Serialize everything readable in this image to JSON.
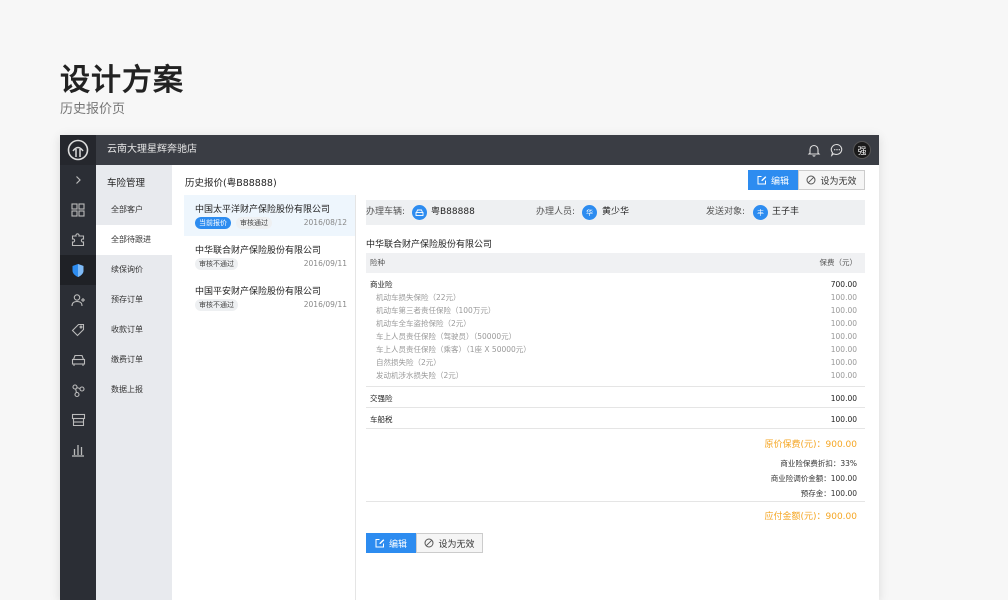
{
  "page": {
    "title": "设计方案",
    "subtitle": "历史报价页"
  },
  "topbar": {
    "store_name": "云南大理星辉奔驰店",
    "avatar": "强",
    "icons": [
      "bell-icon",
      "message-icon"
    ]
  },
  "iconbar": {
    "items": [
      "chevron-right-icon",
      "grid-icon",
      "puzzle-icon",
      "shield-icon",
      "add-user-icon",
      "tag-icon",
      "car-icon",
      "nodes-icon",
      "store-icon",
      "bar-chart-icon"
    ],
    "active_index": 3
  },
  "subnav": {
    "title": "车险管理",
    "items": [
      "全部客户",
      "全部待跟进",
      "续保询价",
      "预存订单",
      "收款订单",
      "缴费订单",
      "数据上报"
    ],
    "active_index": 1
  },
  "toolbar": {
    "title": "历史报价(粤B88888)",
    "edit_label": "编辑",
    "invalidate_label": "设为无效"
  },
  "quotes": [
    {
      "company": "中国太平洋财产保险股份有限公司",
      "tags": [
        "当前报价",
        "审核通过"
      ],
      "date": "2016/08/12",
      "active": true
    },
    {
      "company": "中华联合财产保险股份有限公司",
      "tags": [
        "审核不通过"
      ],
      "date": "2016/09/11",
      "active": false
    },
    {
      "company": "中国平安财产保险股份有限公司",
      "tags": [
        "审核不通过"
      ],
      "date": "2016/09/11",
      "active": false
    }
  ],
  "detail": {
    "vehicle_label": "办理车辆:",
    "vehicle_value": "粤B88888",
    "handler_label": "办理人员:",
    "handler_initial": "华",
    "handler_value": "黄少华",
    "recipient_label": "发送对象:",
    "recipient_initial": "丰",
    "recipient_value": "王子丰",
    "company": "中华联合财产保险股份有限公司",
    "table_head": {
      "name": "险种",
      "fee": "保费（元）"
    },
    "commercial": {
      "name": "商业险",
      "value": "700.00",
      "items": [
        {
          "name": "机动车损失保险（22元）",
          "value": "100.00"
        },
        {
          "name": "机动车第三者责任保险（100万元）",
          "value": "100.00"
        },
        {
          "name": "机动车全车盗抢保险（2元）",
          "value": "100.00"
        },
        {
          "name": "车上人员责任保险（驾驶员）（50000元）",
          "value": "100.00"
        },
        {
          "name": "车上人员责任保险（乘客）（1座 X 50000元）",
          "value": "100.00"
        },
        {
          "name": "自然损失险（2元）",
          "value": "100.00"
        },
        {
          "name": "发动机涉水损失险（2元）",
          "value": "100.00"
        }
      ]
    },
    "compulsory": {
      "name": "交强险",
      "value": "100.00"
    },
    "tax": {
      "name": "车船税",
      "value": "100.00"
    },
    "list_price": "原价保费(元)：900.00",
    "discount": "商业险保费折扣：33%",
    "adjusted": "商业险调价金额：100.00",
    "deposit": "预存金：100.00",
    "payable": "应付金额(元)：900.00",
    "edit_label": "编辑",
    "invalidate_label": "设为无效"
  }
}
